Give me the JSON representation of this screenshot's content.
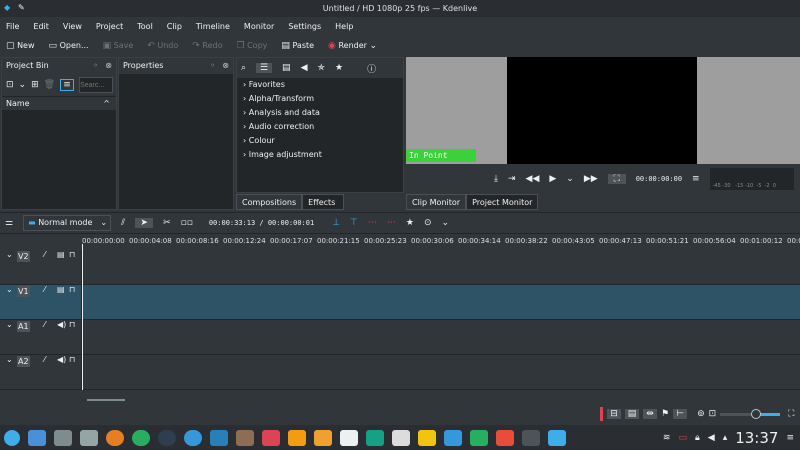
{
  "window": {
    "title": "Untitled / HD 1080p 25 fps — Kdenlive"
  },
  "menu": [
    "File",
    "Edit",
    "View",
    "Project",
    "Tool",
    "Clip",
    "Timeline",
    "Monitor",
    "Settings",
    "Help"
  ],
  "toolbar": {
    "new": "New",
    "open": "Open...",
    "save": "Save",
    "undo": "Undo",
    "redo": "Redo",
    "copy": "Copy",
    "paste": "Paste",
    "render": "Render"
  },
  "project_bin": {
    "title": "Project Bin",
    "search_placeholder": "Searc...",
    "column": "Name"
  },
  "properties": {
    "title": "Properties"
  },
  "effects": {
    "categories": [
      "Favorites",
      "Alpha/Transform",
      "Analysis and data",
      "Audio correction",
      "Colour",
      "Image adjustment"
    ],
    "tabs": [
      "Compositions",
      "Effects"
    ]
  },
  "monitor": {
    "in_point": "In Point",
    "timecode": "00:00:00:00",
    "meter_labels": "-45 -30   -15 -10  -5  -2  0",
    "tabs": [
      "Clip Monitor",
      "Project Monitor"
    ]
  },
  "timeline": {
    "mode": "Normal mode",
    "timecode": "00:00:33:13 / 00:00:00:01",
    "ruler": [
      "00:00:00:00",
      "00:00:04:08",
      "00:00:08:16",
      "00:00:12:24",
      "00:00:17:07",
      "00:00:21:15",
      "00:00:25:23",
      "00:00:30:06",
      "00:00:34:14",
      "00:00:38:22",
      "00:00:43:05",
      "00:00:47:13",
      "00:00:51:21",
      "00:00:56:04",
      "00:01:00:12",
      "00:01:0"
    ],
    "tracks": [
      {
        "name": "V2"
      },
      {
        "name": "V1"
      },
      {
        "name": "A1"
      },
      {
        "name": "A2"
      }
    ],
    "zoom_level": 0.6
  },
  "taskbar": {
    "clock": "13:37"
  },
  "colors": {
    "accent": "#3daee9",
    "in_point": "#3ad13a",
    "selected_track": "#2e5266"
  }
}
